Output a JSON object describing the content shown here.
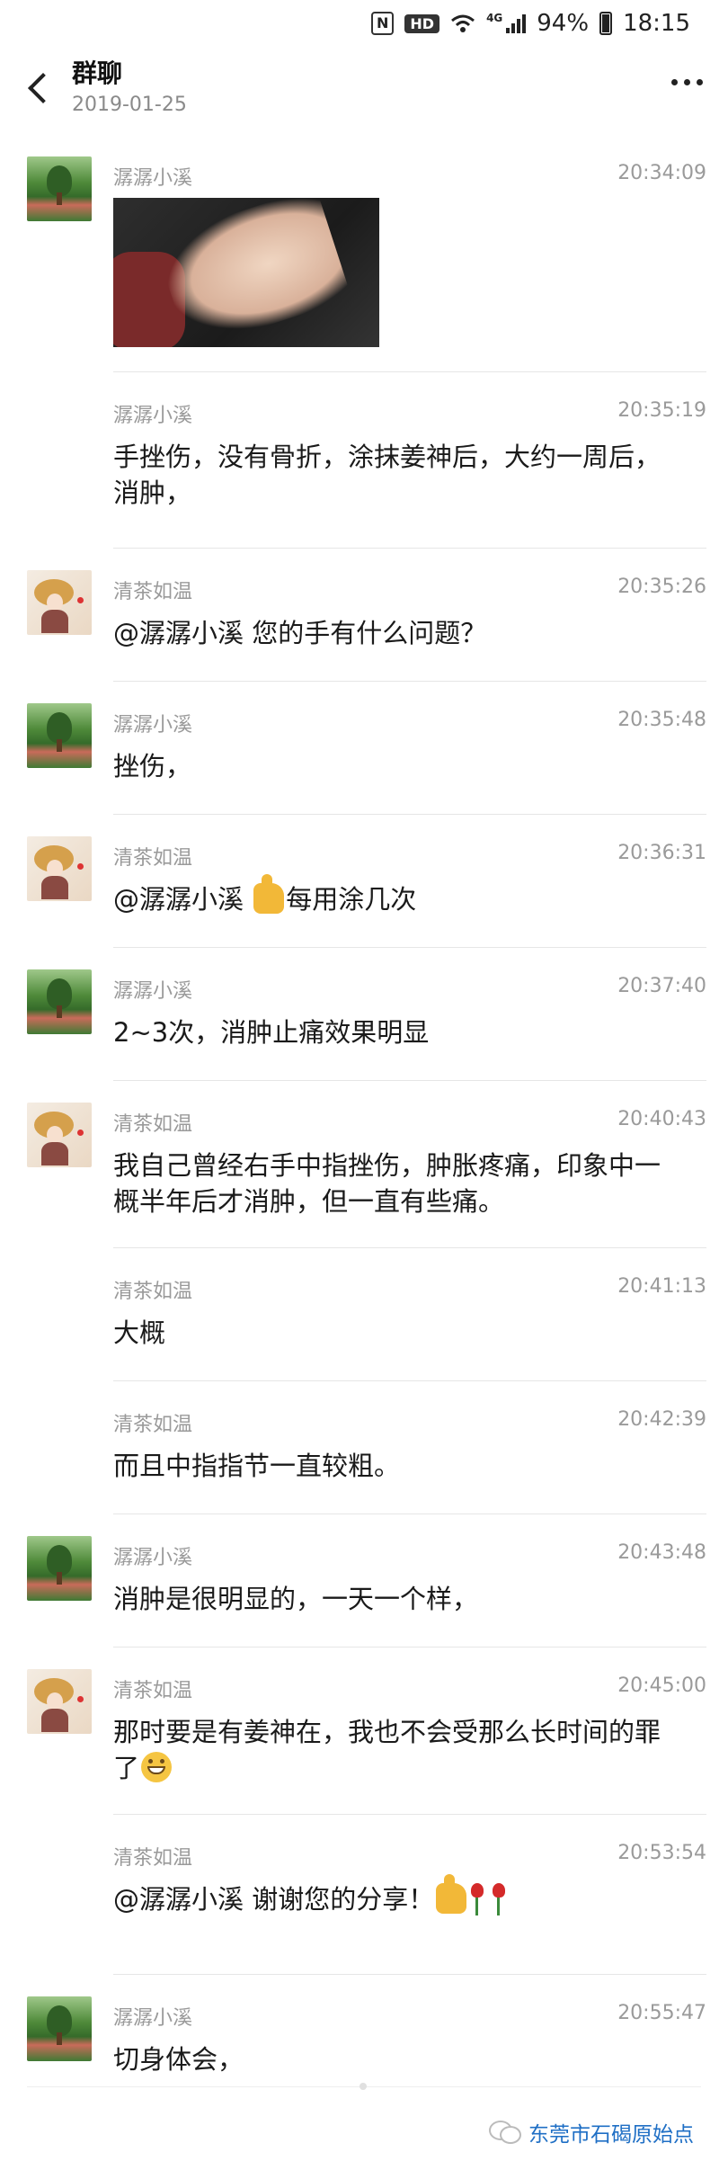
{
  "status_bar": {
    "n_badge": "N",
    "hd": "HD",
    "network": "4G",
    "battery": "94%",
    "time": "18:15"
  },
  "header": {
    "title": "群聊",
    "date": "2019-01-25"
  },
  "messages": [
    {
      "sender": "潺潺小溪",
      "time": "20:34:09",
      "text": "",
      "avatar": "landscape"
    },
    {
      "sender": "潺潺小溪",
      "time": "20:35:19",
      "text": "手挫伤，没有骨折，涂抹姜神后，大约一周后，消肿，",
      "avatar": ""
    },
    {
      "sender": "清茶如温",
      "time": "20:35:26",
      "text": "@潺潺小溪 您的手有什么问题？",
      "avatar": "girl-hat"
    },
    {
      "sender": "潺潺小溪",
      "time": "20:35:48",
      "text": "挫伤，",
      "avatar": "landscape"
    },
    {
      "sender": "清茶如温",
      "time": "20:36:31",
      "text_before": "@潺潺小溪 ",
      "text_after": "每用涂几次",
      "avatar": "girl-hat"
    },
    {
      "sender": "潺潺小溪",
      "time": "20:37:40",
      "text": "2~3次，消肿止痛效果明显",
      "avatar": "landscape"
    },
    {
      "sender": "清茶如温",
      "time": "20:40:43",
      "text": "我自己曾经右手中指挫伤，肿胀疼痛，印象中一概半年后才消肿，但一直有些痛。",
      "avatar": "girl-hat"
    },
    {
      "sender": "清茶如温",
      "time": "20:41:13",
      "text": "大概",
      "avatar": ""
    },
    {
      "sender": "清茶如温",
      "time": "20:42:39",
      "text": "而且中指指节一直较粗。",
      "avatar": ""
    },
    {
      "sender": "潺潺小溪",
      "time": "20:43:48",
      "text": "消肿是很明显的，一天一个样，",
      "avatar": "landscape"
    },
    {
      "sender": "清茶如温",
      "time": "20:45:00",
      "text": "那时要是有姜神在，我也不会受那么长时间的罪了",
      "avatar": "girl-hat"
    },
    {
      "sender": "清茶如温",
      "time": "20:53:54",
      "text": "@潺潺小溪 谢谢您的分享！",
      "avatar": ""
    },
    {
      "sender": "潺潺小溪",
      "time": "20:55:47",
      "text": "切身体会，",
      "avatar": "landscape"
    }
  ],
  "watermark": "东莞市石碣原始点"
}
